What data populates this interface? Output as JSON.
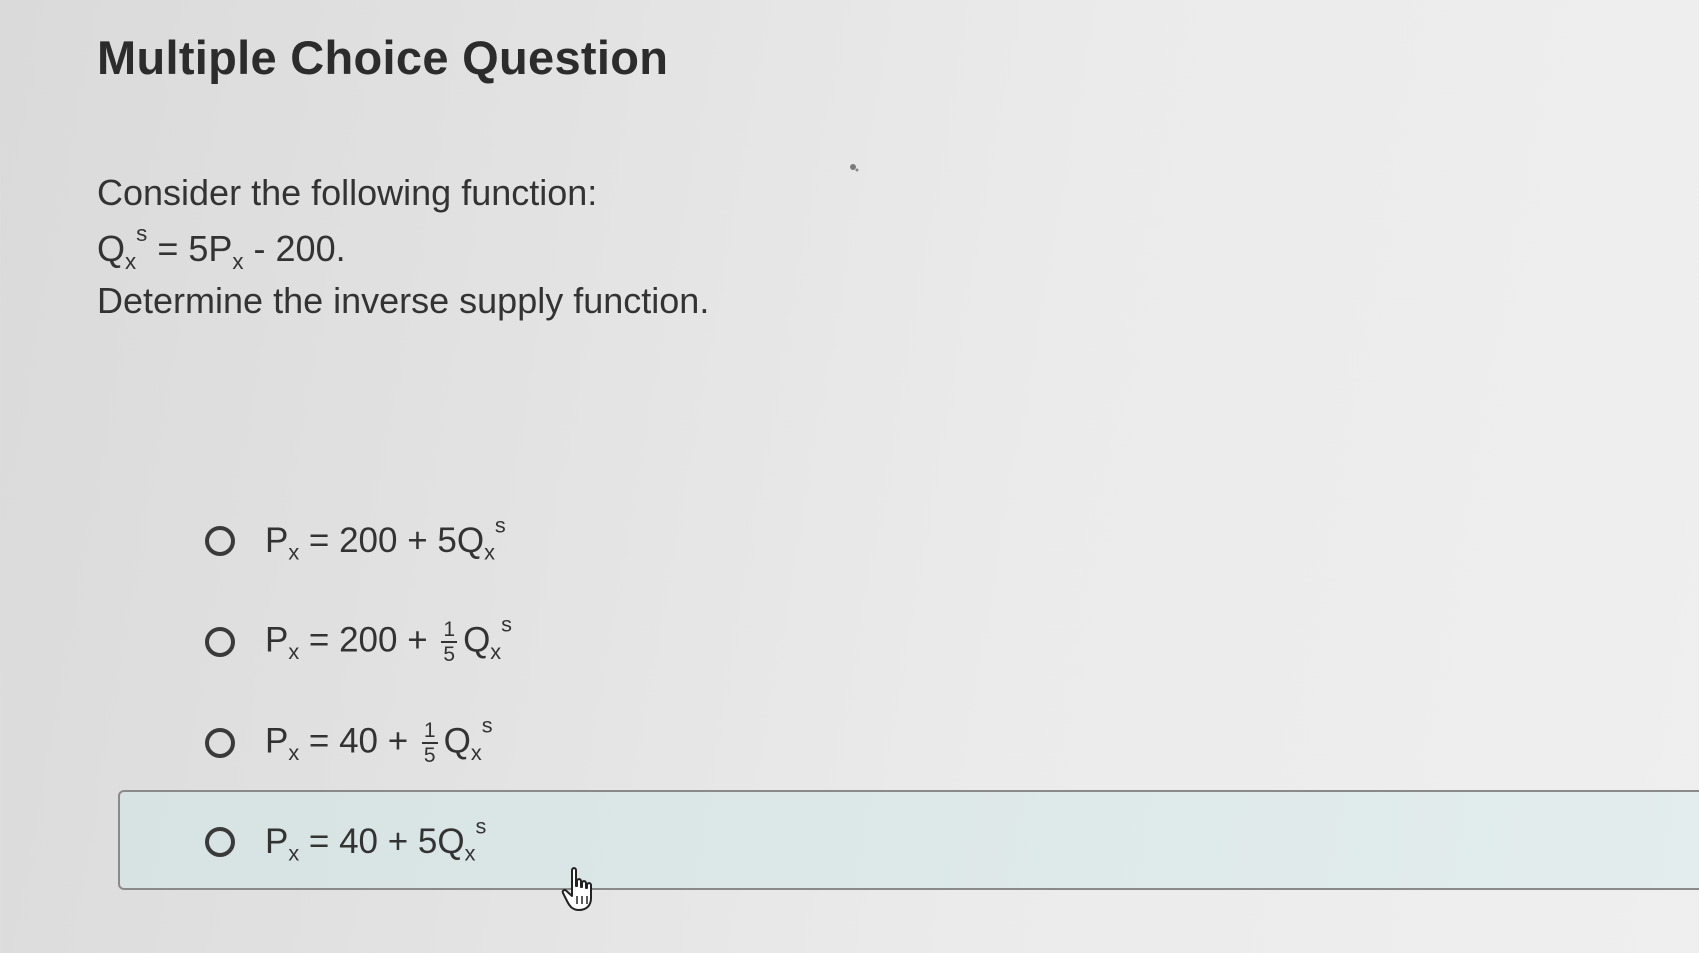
{
  "title": "Multiple Choice Question",
  "prompt": {
    "line1": "Consider the following function:",
    "equation": {
      "lhs_base": "Q",
      "lhs_sub": "x",
      "lhs_sup": "s",
      "op": " = 5P",
      "rhs_sub": "x",
      "tail": " - 200."
    },
    "line3": "Determine the inverse supply function."
  },
  "options": [
    {
      "p": "P",
      "p_sub": "x",
      "middle": " = 200 + 5Q",
      "q_sub": "x",
      "q_sup": "s",
      "selected": false
    },
    {
      "p": "P",
      "p_sub": "x",
      "middle": " = 200 + ",
      "frac_num": "1",
      "frac_den": "5",
      "q": "Q",
      "q_sub": "x",
      "q_sup": "s",
      "selected": false
    },
    {
      "p": "P",
      "p_sub": "x",
      "middle": " = 40 + ",
      "frac_num": "1",
      "frac_den": "5",
      "q": "Q",
      "q_sub": "x",
      "q_sup": "s",
      "selected": false
    },
    {
      "p": "P",
      "p_sub": "x",
      "middle": " = 40 + 5Q",
      "q_sub": "x",
      "q_sup": "s",
      "selected": false,
      "hovered": true
    }
  ],
  "icons": {
    "radio": "radio-unchecked-icon",
    "cursor": "hand-pointer-icon"
  },
  "colors": {
    "background": "#e6e6e6",
    "hover_fill": "#dde8e8",
    "hover_border": "#8a8a8a",
    "text": "#2f2f2f"
  }
}
